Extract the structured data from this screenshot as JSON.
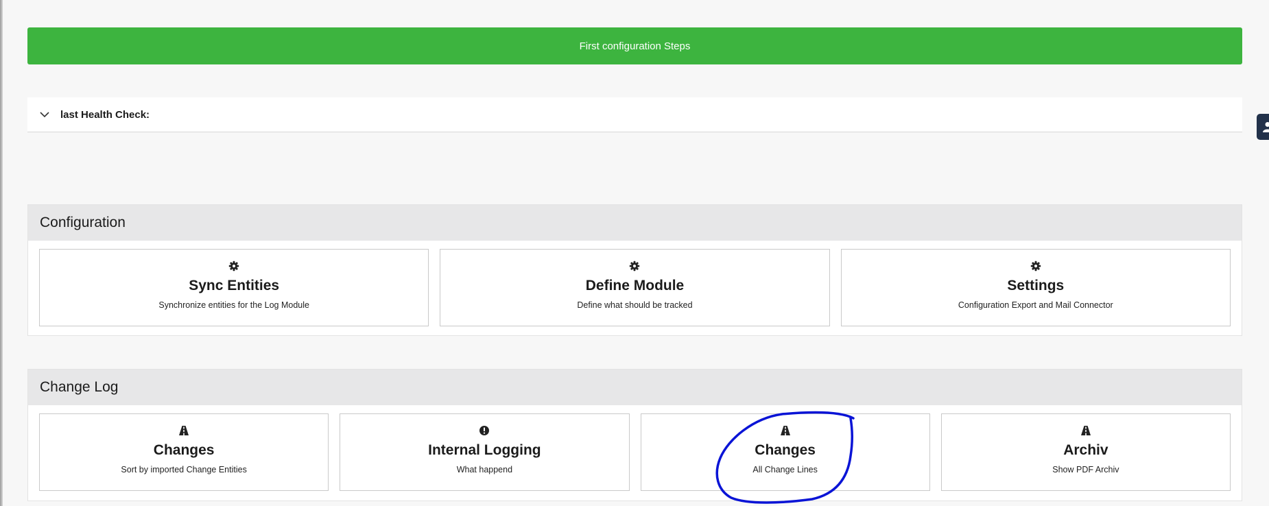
{
  "banner": {
    "label": "First configuration Steps"
  },
  "health": {
    "label": "last Health Check:"
  },
  "configuration": {
    "title": "Configuration",
    "cards": [
      {
        "icon": "gear-icon",
        "title": "Sync Entities",
        "subtitle": "Synchronize entities for the Log Module"
      },
      {
        "icon": "gear-icon",
        "title": "Define Module",
        "subtitle": "Define what should be tracked"
      },
      {
        "icon": "gear-icon",
        "title": "Settings",
        "subtitle": "Configuration Export and Mail Connector"
      }
    ]
  },
  "change_log": {
    "title": "Change Log",
    "cards": [
      {
        "icon": "road-icon",
        "title": "Changes",
        "subtitle": "Sort by imported Change Entities"
      },
      {
        "icon": "exclamation-circle-icon",
        "title": "Internal Logging",
        "subtitle": "What happend"
      },
      {
        "icon": "road-icon",
        "title": "Changes",
        "subtitle": "All Change Lines"
      },
      {
        "icon": "road-icon",
        "title": "Archiv",
        "subtitle": "Show PDF Archiv"
      }
    ]
  },
  "colors": {
    "banner_green": "#3db43f",
    "annotation_blue": "#0a14d6",
    "side_tab": "#22314a"
  }
}
